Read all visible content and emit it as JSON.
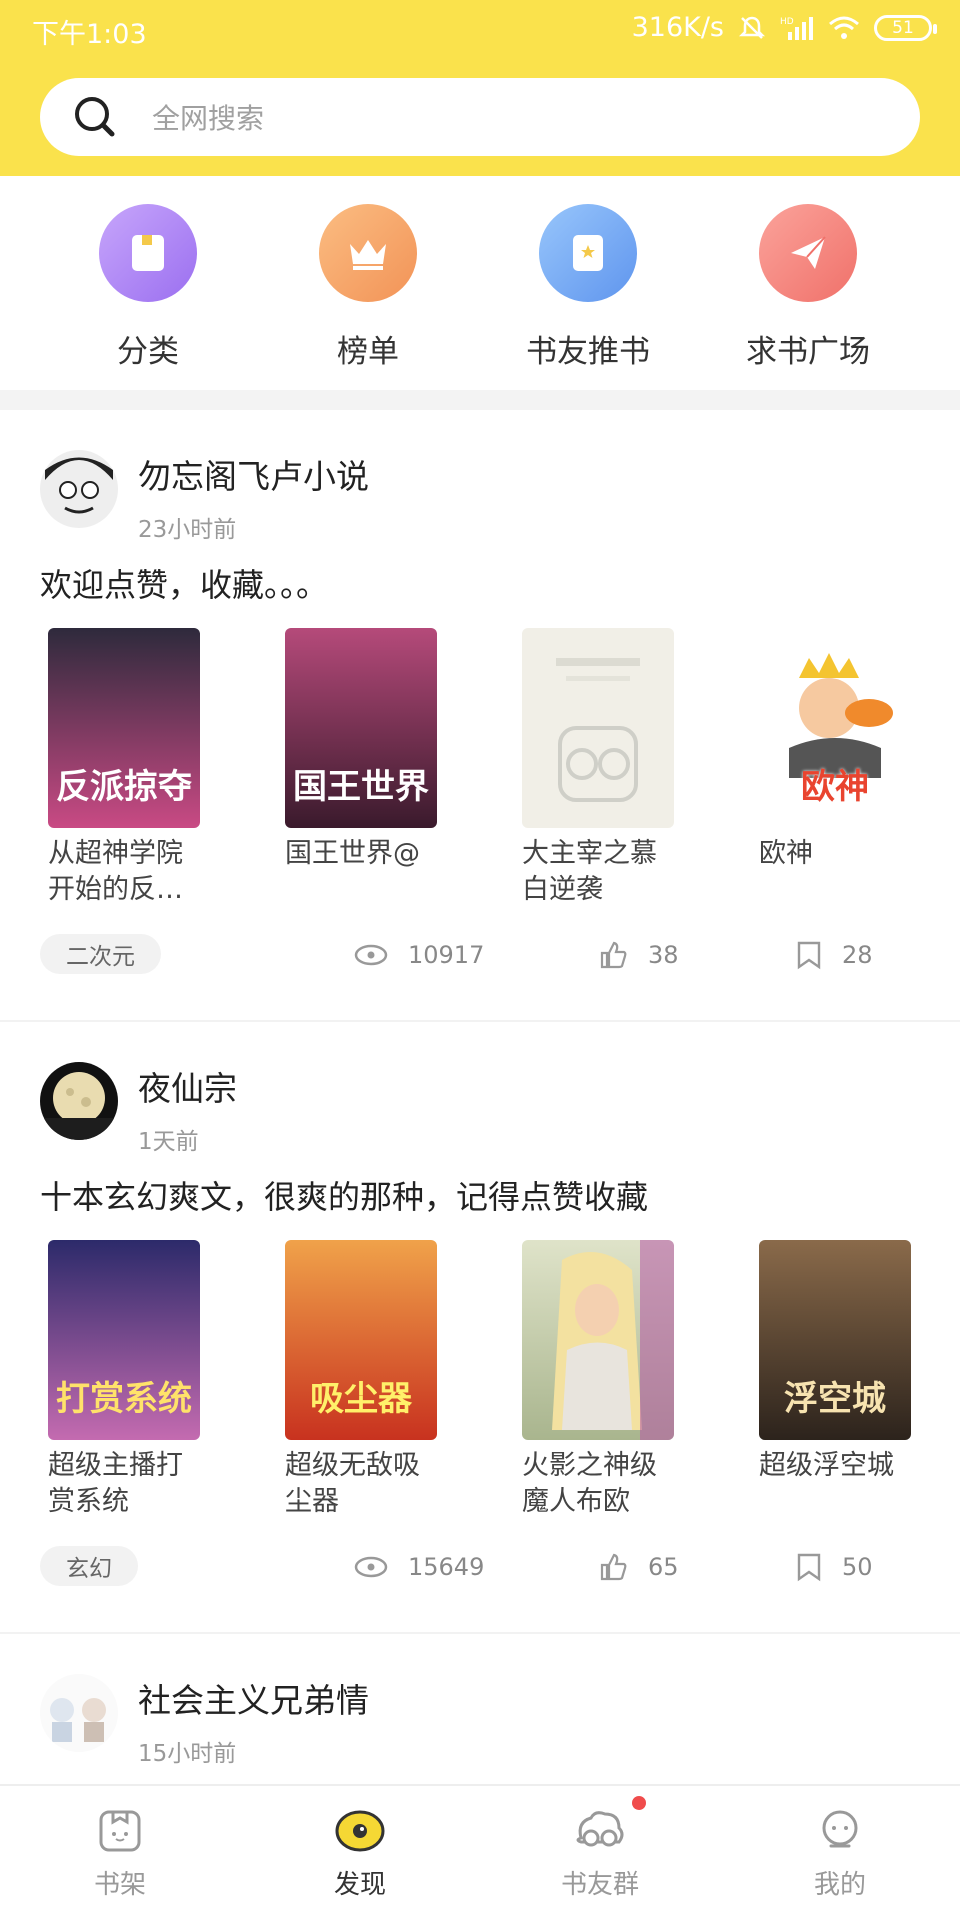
{
  "status_bar": {
    "time": "下午1:03",
    "speed": "316K/s",
    "battery": "51"
  },
  "search": {
    "placeholder": "全网搜索"
  },
  "quick_nav": [
    {
      "label": "分类",
      "icon": "category-icon",
      "color": "#b48cf5"
    },
    {
      "label": "榜单",
      "icon": "crown-icon",
      "color": "#f6a86b"
    },
    {
      "label": "书友推书",
      "icon": "bookmark-icon",
      "color": "#7cb2f5"
    },
    {
      "label": "求书广场",
      "icon": "paper-plane-icon",
      "color": "#f58b82"
    }
  ],
  "posts": [
    {
      "user": "勿忘阁飞卢小说",
      "time": "23小时前",
      "text": "欢迎点赞，收藏。。。",
      "books": [
        {
          "title": "从超神学院开始的反…",
          "cover_text": "反派掠夺",
          "cover_color": "#3a2a44"
        },
        {
          "title": "国王世界@",
          "cover_text": "国王世界",
          "cover_color": "#5a2740"
        },
        {
          "title": "大主宰之慕白逆袭",
          "cover_text": "",
          "cover_color": "#f1efe7"
        },
        {
          "title": "欧神",
          "cover_text": "欧神",
          "cover_color": "#ffffff"
        }
      ],
      "tag": "二次元",
      "views": "10917",
      "likes": "38",
      "saves": "28"
    },
    {
      "user": "夜仙宗",
      "time": "1天前",
      "text": "十本玄幻爽文，很爽的那种，记得点赞收藏",
      "books": [
        {
          "title": "超级主播打赏系统",
          "cover_text": "打赏系统",
          "cover_color": "#4a3a8a"
        },
        {
          "title": "超级无敌吸尘器",
          "cover_text": "吸尘器",
          "cover_color": "#d8502f"
        },
        {
          "title": "火影之神级魔人布欧",
          "cover_text": "",
          "cover_color": "#cfd6b8"
        },
        {
          "title": "超级浮空城",
          "cover_text": "浮空城",
          "cover_color": "#5b4a3a"
        }
      ],
      "tag": "玄幻",
      "views": "15649",
      "likes": "65",
      "saves": "50"
    },
    {
      "user": "社会主义兄弟情",
      "time": "15小时前"
    }
  ],
  "bottom_nav": [
    {
      "label": "书架",
      "icon": "bookshelf-icon"
    },
    {
      "label": "发现",
      "icon": "discover-eye-icon",
      "active": true
    },
    {
      "label": "书友群",
      "icon": "group-icon",
      "badge": true
    },
    {
      "label": "我的",
      "icon": "profile-icon"
    }
  ]
}
